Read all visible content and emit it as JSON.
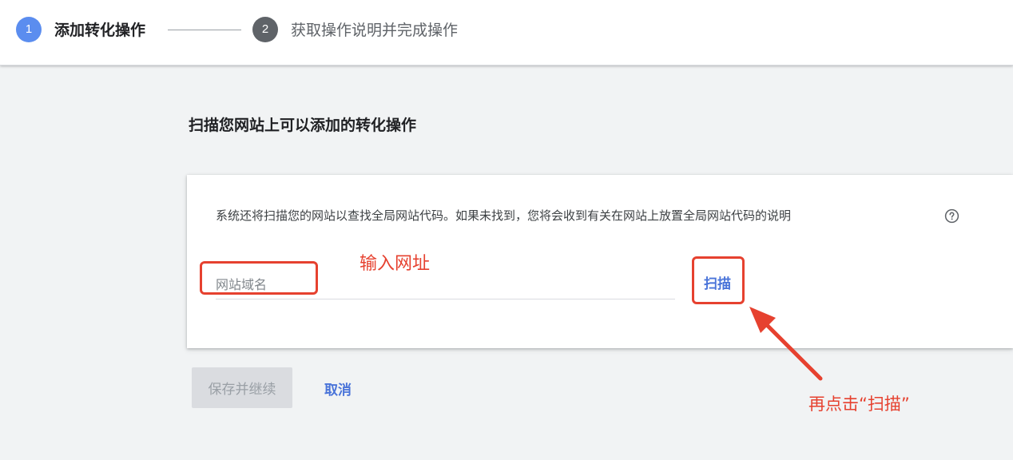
{
  "stepper": {
    "step1": {
      "number": "1",
      "label": "添加转化操作"
    },
    "step2": {
      "number": "2",
      "label": "获取操作说明并完成操作"
    }
  },
  "main": {
    "title": "扫描您网站上可以添加的转化操作",
    "card": {
      "description": "系统还将扫描您的网站以查找全局网站代码。如果未找到，您将会收到有关在网站上放置全局网站代码的说明",
      "help_icon": "help-circle-icon",
      "input_placeholder": "网站域名",
      "input_value": "",
      "scan_label": "扫描"
    },
    "buttons": {
      "save_label": "保存并继续",
      "cancel_label": "取消"
    }
  },
  "annotations": {
    "input_hint": "输入网址",
    "scan_hint": "再点击“扫描”",
    "color": "#e6412f"
  },
  "colors": {
    "accent_blue": "#4a74d9",
    "active_step": "#5b8def",
    "inactive_step": "#5f6368",
    "page_bg": "#f1f3f4"
  }
}
